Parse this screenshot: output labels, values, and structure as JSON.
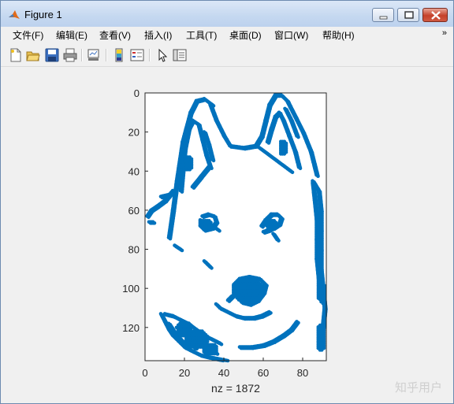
{
  "window": {
    "title": "Figure 1",
    "controls": [
      "minimize-icon",
      "restore-icon",
      "close-icon"
    ]
  },
  "menubar": {
    "items": [
      {
        "label": "文件(F)"
      },
      {
        "label": "编辑(E)"
      },
      {
        "label": "查看(V)"
      },
      {
        "label": "插入(I)"
      },
      {
        "label": "工具(T)"
      },
      {
        "label": "桌面(D)"
      },
      {
        "label": "窗口(W)"
      },
      {
        "label": "帮助(H)"
      }
    ],
    "overflow_icon": "chevron-double-icon"
  },
  "toolbar": {
    "buttons": [
      "new-figure-icon",
      "open-file-icon",
      "save-icon",
      "print-icon",
      "link-plot-icon",
      "insert-colorbar-icon",
      "insert-legend-icon",
      "edit-plot-arrow-icon",
      "property-editor-icon"
    ]
  },
  "chart_data": {
    "type": "scatter",
    "description": "spy plot of sparse matrix (edge image of a husky dog face)",
    "xlim": [
      0,
      92
    ],
    "ylim": [
      137,
      0
    ],
    "x_ticks": [
      "0",
      "20",
      "40",
      "60",
      "80"
    ],
    "y_ticks": [
      "0",
      "20",
      "40",
      "60",
      "80",
      "100",
      "120"
    ],
    "xlabel": "nz = 1872",
    "marker_color": "#0072bd",
    "grid": false
  },
  "watermark": "知乎用户"
}
